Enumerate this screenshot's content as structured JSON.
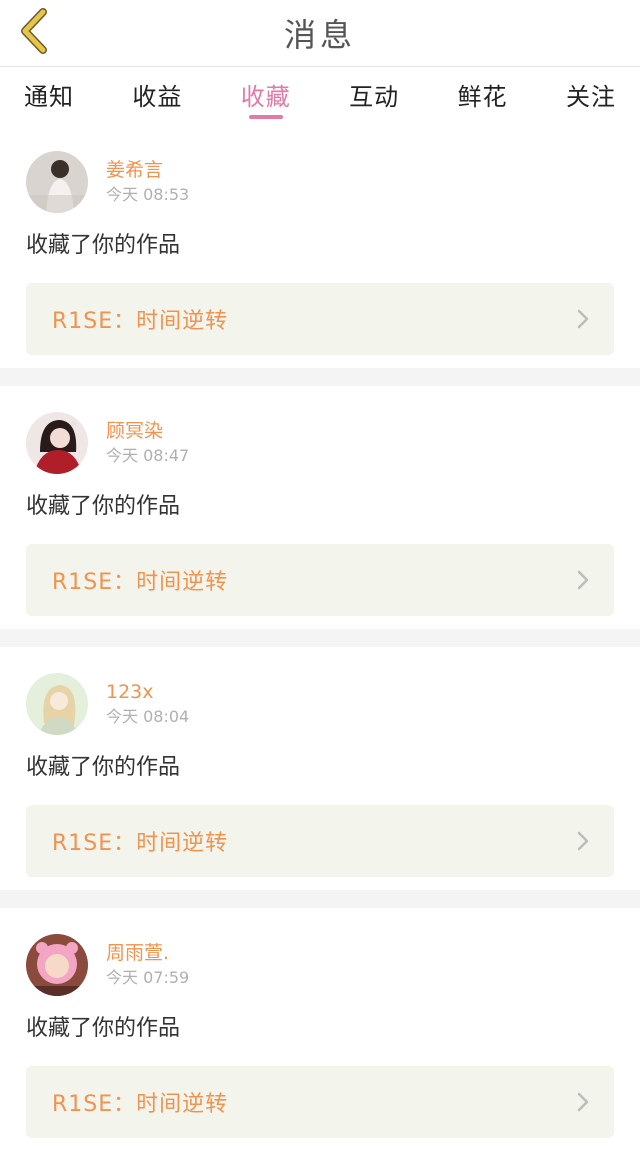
{
  "header": {
    "title": "消息",
    "back_icon": "chevron-left-icon",
    "back_icon_color": "#e6c54a"
  },
  "tabs": [
    {
      "label": "通知",
      "active": false
    },
    {
      "label": "收益",
      "active": false
    },
    {
      "label": "收藏",
      "active": true
    },
    {
      "label": "互动",
      "active": false
    },
    {
      "label": "鲜花",
      "active": false
    },
    {
      "label": "关注",
      "active": false
    }
  ],
  "colors": {
    "accent": "#e27aa8",
    "username": "#f0934f",
    "work_bg": "#f3f4ec"
  },
  "messages": [
    {
      "user": "姜希言",
      "time": "今天 08:53",
      "action": "收藏了你的作品",
      "work": "R1SE：时间逆转"
    },
    {
      "user": "顾冥染",
      "time": "今天 08:47",
      "action": "收藏了你的作品",
      "work": "R1SE：时间逆转"
    },
    {
      "user": "123x",
      "time": "今天 08:04",
      "action": "收藏了你的作品",
      "work": "R1SE：时间逆转"
    },
    {
      "user": "周雨萱.",
      "time": "今天 07:59",
      "action": "收藏了你的作品",
      "work": "R1SE：时间逆转"
    }
  ]
}
